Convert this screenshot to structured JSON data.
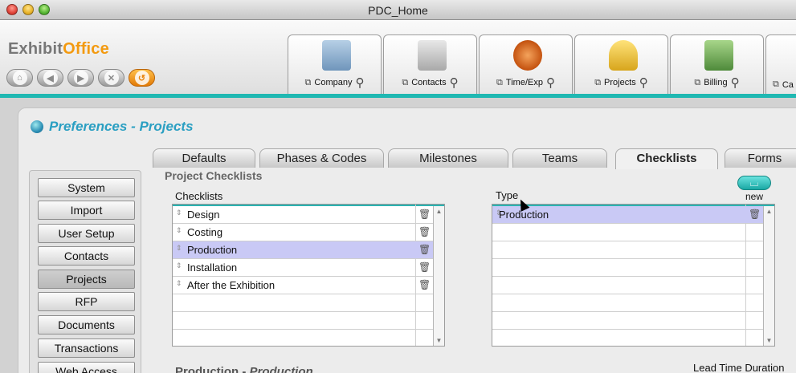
{
  "window": {
    "title": "PDC_Home"
  },
  "brand": {
    "part1": "Exhibit",
    "part2": "Office"
  },
  "nav_buttons": [
    {
      "icon": "home-icon",
      "glyph": "⌂"
    },
    {
      "icon": "back-icon",
      "glyph": "◀"
    },
    {
      "icon": "forward-icon",
      "glyph": "▶"
    },
    {
      "icon": "close-icon",
      "glyph": "✕"
    },
    {
      "icon": "refresh-icon",
      "glyph": "↺"
    }
  ],
  "modules": [
    {
      "label": "Company",
      "color": "#7fa6c9"
    },
    {
      "label": "Contacts",
      "color": "#b9b9b9"
    },
    {
      "label": "Time/Exp",
      "color": "#e07a2a"
    },
    {
      "label": "Projects",
      "color": "#e6c23a"
    },
    {
      "label": "Billing",
      "color": "#5c9a4a"
    },
    {
      "label": "Ca",
      "color": "#c9a060"
    }
  ],
  "page": {
    "title": "Preferences - Projects"
  },
  "tabs": [
    {
      "label": "Defaults",
      "active": false
    },
    {
      "label": "Phases & Codes",
      "active": false
    },
    {
      "label": "Milestones",
      "active": false
    },
    {
      "label": "Teams",
      "active": false
    },
    {
      "label": "Checklists",
      "active": true
    },
    {
      "label": "Forms",
      "active": false
    }
  ],
  "sidebar": {
    "items": [
      {
        "label": "System",
        "active": false
      },
      {
        "label": "Import",
        "active": false
      },
      {
        "label": "User Setup",
        "active": false
      },
      {
        "label": "Contacts",
        "active": false
      },
      {
        "label": "Projects",
        "active": true
      },
      {
        "label": "RFP",
        "active": false
      },
      {
        "label": "Documents",
        "active": false
      },
      {
        "label": "Transactions",
        "active": false
      },
      {
        "label": "Web Access",
        "active": false
      }
    ]
  },
  "section": {
    "title": "Project Checklists"
  },
  "checklists": {
    "header": "Checklists",
    "rows": [
      "Design",
      "Costing",
      "Production",
      "Installation",
      "After the Exhibition"
    ],
    "selected": "Production"
  },
  "types": {
    "header": "Type",
    "rows": [
      "Production"
    ],
    "selected": "Production"
  },
  "new_button": {
    "label": "new"
  },
  "bottom": {
    "title_part1": "Production",
    "title_sep": " - ",
    "title_part2": "Production",
    "right_text": "Lead Time  Duration"
  },
  "colors": {
    "accent": "#20b8b2",
    "title_blue": "#2a9fc2",
    "selection": "#c9c9f5",
    "brand_orange": "#f39a10"
  }
}
